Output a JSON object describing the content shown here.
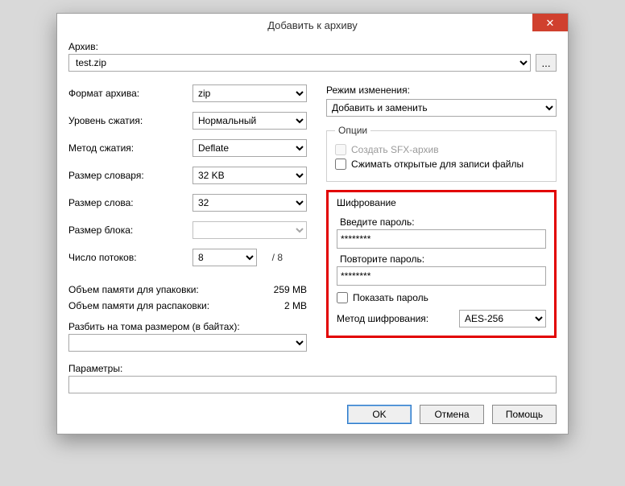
{
  "window": {
    "title": "Добавить к архиву",
    "close": "✕"
  },
  "archive": {
    "label": "Архив:",
    "value": "test.zip",
    "browse": "..."
  },
  "left": {
    "format_label": "Формат архива:",
    "format_value": "zip",
    "level_label": "Уровень сжатия:",
    "level_value": "Нормальный",
    "method_label": "Метод сжатия:",
    "method_value": "Deflate",
    "dict_label": "Размер словаря:",
    "dict_value": "32 KB",
    "word_label": "Размер слова:",
    "word_value": "32",
    "block_label": "Размер блока:",
    "block_value": "",
    "threads_label": "Число потоков:",
    "threads_value": "8",
    "threads_max": "/ 8",
    "mem_pack_label": "Объем памяти для упаковки:",
    "mem_pack_value": "259 MB",
    "mem_unpack_label": "Объем памяти для распаковки:",
    "mem_unpack_value": "2 MB",
    "split_label": "Разбить на тома размером (в байтах):",
    "split_value": ""
  },
  "right": {
    "mode_label": "Режим изменения:",
    "mode_value": "Добавить и заменить",
    "options_legend": "Опции",
    "opt_sfx": "Создать SFX-архив",
    "opt_shared": "Сжимать открытые для записи файлы",
    "enc_title": "Шифрование",
    "enc_pw1_label": "Введите пароль:",
    "enc_pw1_value": "********",
    "enc_pw2_label": "Повторите пароль:",
    "enc_pw2_value": "********",
    "enc_show": "Показать пароль",
    "enc_method_label": "Метод шифрования:",
    "enc_method_value": "AES-256"
  },
  "params": {
    "label": "Параметры:",
    "value": ""
  },
  "buttons": {
    "ok": "OK",
    "cancel": "Отмена",
    "help": "Помощь"
  }
}
